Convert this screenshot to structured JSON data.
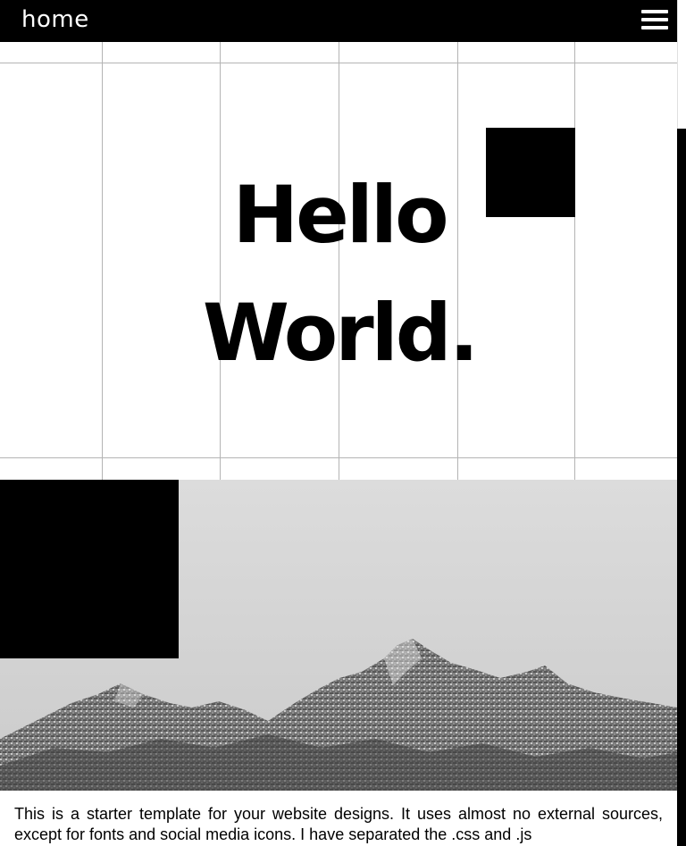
{
  "nav": {
    "home_label": "home",
    "menu_icon": "hamburger-menu-icon"
  },
  "hero": {
    "title_line1": "Hello",
    "title_line2": "World."
  },
  "image_section": {
    "subject": "mountain-range-photo"
  },
  "intro": {
    "text": "This is a starter template for your website designs. It uses almost no external sources, except for fonts and social media icons. I have separated the .css and .js"
  },
  "colors": {
    "bar": "#000000",
    "grid_line": "#b4b4b4",
    "background": "#ffffff"
  }
}
